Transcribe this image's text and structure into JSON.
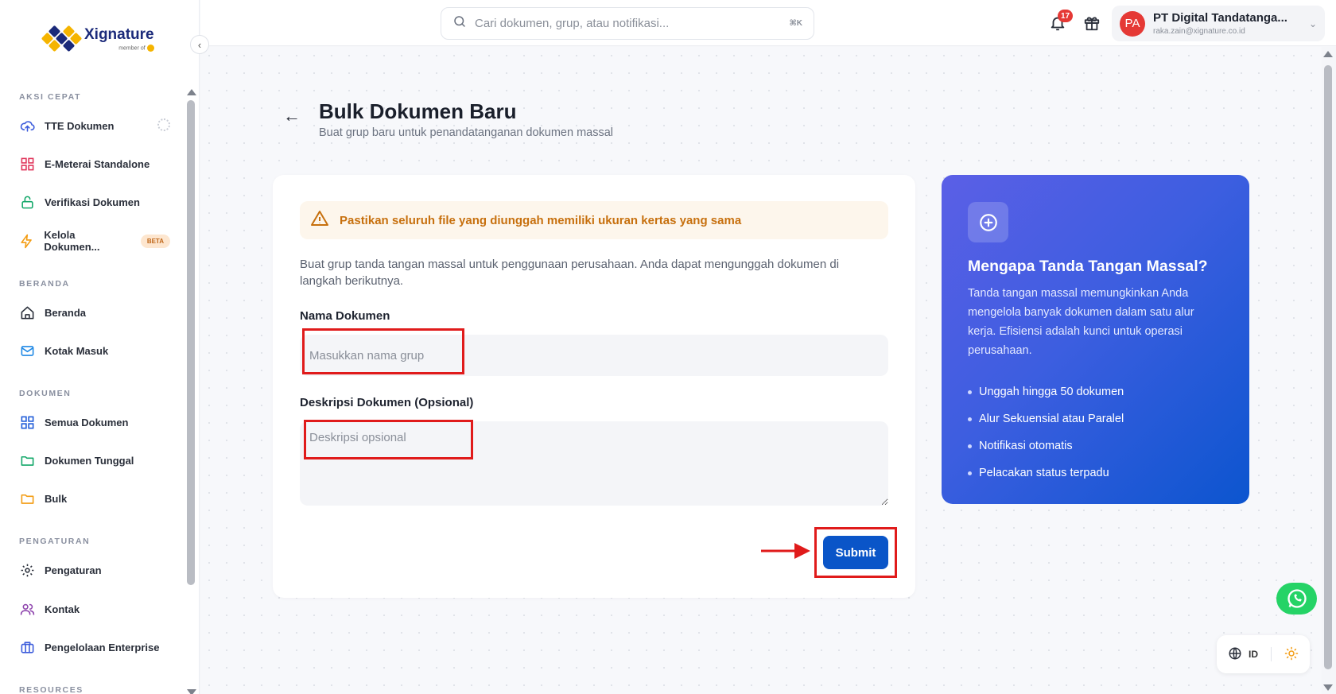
{
  "brand": {
    "name": "Xignature",
    "tagline": "member of",
    "colors": {
      "primary": "#0a55c8",
      "accent": "#e53935",
      "warn": "#c7700e"
    }
  },
  "sidebar": {
    "sections": [
      {
        "label": "AKSI CEPAT",
        "items": [
          {
            "label": "TTE Dokumen",
            "icon": "cloud-upload-icon"
          },
          {
            "label": "E-Meterai Standalone",
            "icon": "grid-icon"
          },
          {
            "label": "Verifikasi Dokumen",
            "icon": "lock-icon"
          },
          {
            "label": "Kelola Dokumen...",
            "icon": "bolt-icon",
            "badge": "BETA"
          }
        ]
      },
      {
        "label": "BERANDA",
        "items": [
          {
            "label": "Beranda",
            "icon": "home-icon"
          },
          {
            "label": "Kotak Masuk",
            "icon": "mail-icon"
          }
        ]
      },
      {
        "label": "DOKUMEN",
        "items": [
          {
            "label": "Semua Dokumen",
            "icon": "grid-icon"
          },
          {
            "label": "Dokumen Tunggal",
            "icon": "folder-icon"
          },
          {
            "label": "Bulk",
            "icon": "folder-icon"
          }
        ]
      },
      {
        "label": "PENGATURAN",
        "items": [
          {
            "label": "Pengaturan",
            "icon": "gear-icon"
          },
          {
            "label": "Kontak",
            "icon": "users-icon"
          },
          {
            "label": "Pengelolaan Enterprise",
            "icon": "briefcase-icon"
          }
        ]
      },
      {
        "label": "RESOURCES",
        "items": []
      }
    ]
  },
  "topbar": {
    "search_placeholder": "Cari dokumen, grup, atau notifikasi...",
    "search_shortcut": "⌘K",
    "notification_count": "17",
    "account": {
      "initials": "PA",
      "name": "PT Digital Tandatanga...",
      "email": "raka.zain@xignature.co.id"
    }
  },
  "page": {
    "title": "Bulk Dokumen Baru",
    "subtitle": "Buat grup baru untuk penandatanganan dokumen massal"
  },
  "form": {
    "warning": "Pastikan seluruh file yang diunggah memiliki ukuran kertas yang sama",
    "description": "Buat grup tanda tangan massal untuk penggunaan perusahaan. Anda dapat mengunggah dokumen di langkah berikutnya.",
    "name_label": "Nama Dokumen",
    "name_placeholder": "Masukkan nama grup",
    "name_value": "",
    "desc_label": "Deskripsi Dokumen (Opsional)",
    "desc_placeholder": "Deskripsi opsional",
    "desc_value": "",
    "submit_label": "Submit"
  },
  "info": {
    "title": "Mengapa Tanda Tangan Massal?",
    "text": "Tanda tangan massal memungkinkan Anda mengelola banyak dokumen dalam satu alur kerja. Efisiensi adalah kunci untuk operasi perusahaan.",
    "points": [
      "Unggah hingga 50 dokumen",
      "Alur Sekuensial atau Paralel",
      "Notifikasi otomatis",
      "Pelacakan status terpadu"
    ]
  },
  "footer": {
    "language": "ID"
  }
}
